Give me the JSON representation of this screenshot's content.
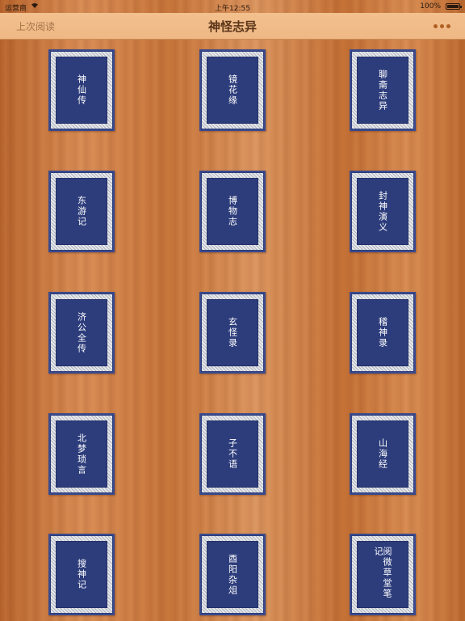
{
  "status_bar": {
    "carrier": "运营商",
    "time": "上午12:55",
    "battery": "100%"
  },
  "nav": {
    "back_label": "上次阅读",
    "title": "神怪志异",
    "more_icon": "ellipsis-icon"
  },
  "books": [
    "神仙传",
    "镜花缘",
    "聊斋志异",
    "东游记",
    "博物志",
    "封神演义",
    "济公全传",
    "玄怪录",
    "稽神录",
    "北梦琐言",
    "子不语",
    "山海经",
    "搜神记",
    "酉阳杂俎",
    "阅微草堂笔记"
  ]
}
